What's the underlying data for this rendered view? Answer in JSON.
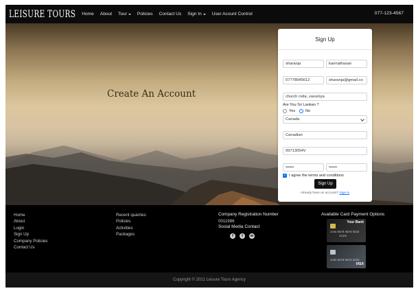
{
  "navbar": {
    "brand": "LEISURE TOURS",
    "items": [
      {
        "label": "Home",
        "dropdown": false
      },
      {
        "label": "About",
        "dropdown": false
      },
      {
        "label": "Tour",
        "dropdown": true
      },
      {
        "label": "Policies",
        "dropdown": false
      },
      {
        "label": "Contact Us",
        "dropdown": false
      },
      {
        "label": "Sign In",
        "dropdown": true
      },
      {
        "label": "User Acount Control",
        "dropdown": false
      }
    ],
    "phone": "077-123-4567"
  },
  "hero": {
    "title": "Create An Account"
  },
  "signup": {
    "title": "Sign Up",
    "first_name": "sharanja",
    "last_name": "kannathasan",
    "phone": "07778945612",
    "email": "sharanja@gmail.co",
    "address": "church roda, vavuniya",
    "sri_lankan_question": "Are You Sri Lankan ?",
    "yes_label": "Yes",
    "no_label": "No",
    "sri_lankan_selected": "No",
    "country": "Canada",
    "nationality": "Canadian",
    "nic": "99713054V",
    "password": "••••••",
    "confirm_password": "••••••",
    "terms_label": "I agree the terms and conditions",
    "terms_checked": true,
    "submit_label": "Sign Up",
    "login_prompt": "Already have an account?",
    "login_link": "Sign in"
  },
  "footer": {
    "col1": [
      "Home",
      "About",
      "Login",
      "Sign Up",
      "Company Policies",
      "Contact Us"
    ],
    "col2": [
      "Recent quarries",
      "Policies",
      "Activities",
      "Packages"
    ],
    "company_reg_heading": "Company Registration Number",
    "company_reg_number": "0011986",
    "social_heading": "Social Media Contact",
    "social_icons": [
      "facebook-icon",
      "twitter-icon",
      "whatsapp-icon"
    ],
    "payment_heading": "Available Card Payment Options",
    "card1": {
      "bank": "Your Bank",
      "number": "1234 5678 9876 5432",
      "expiry": "12/25"
    },
    "card2": {
      "number": "1234 5678 9876 5432",
      "brand": "VISA"
    },
    "copyright": "Copyright © 2021 Leisure Tours Agency"
  }
}
